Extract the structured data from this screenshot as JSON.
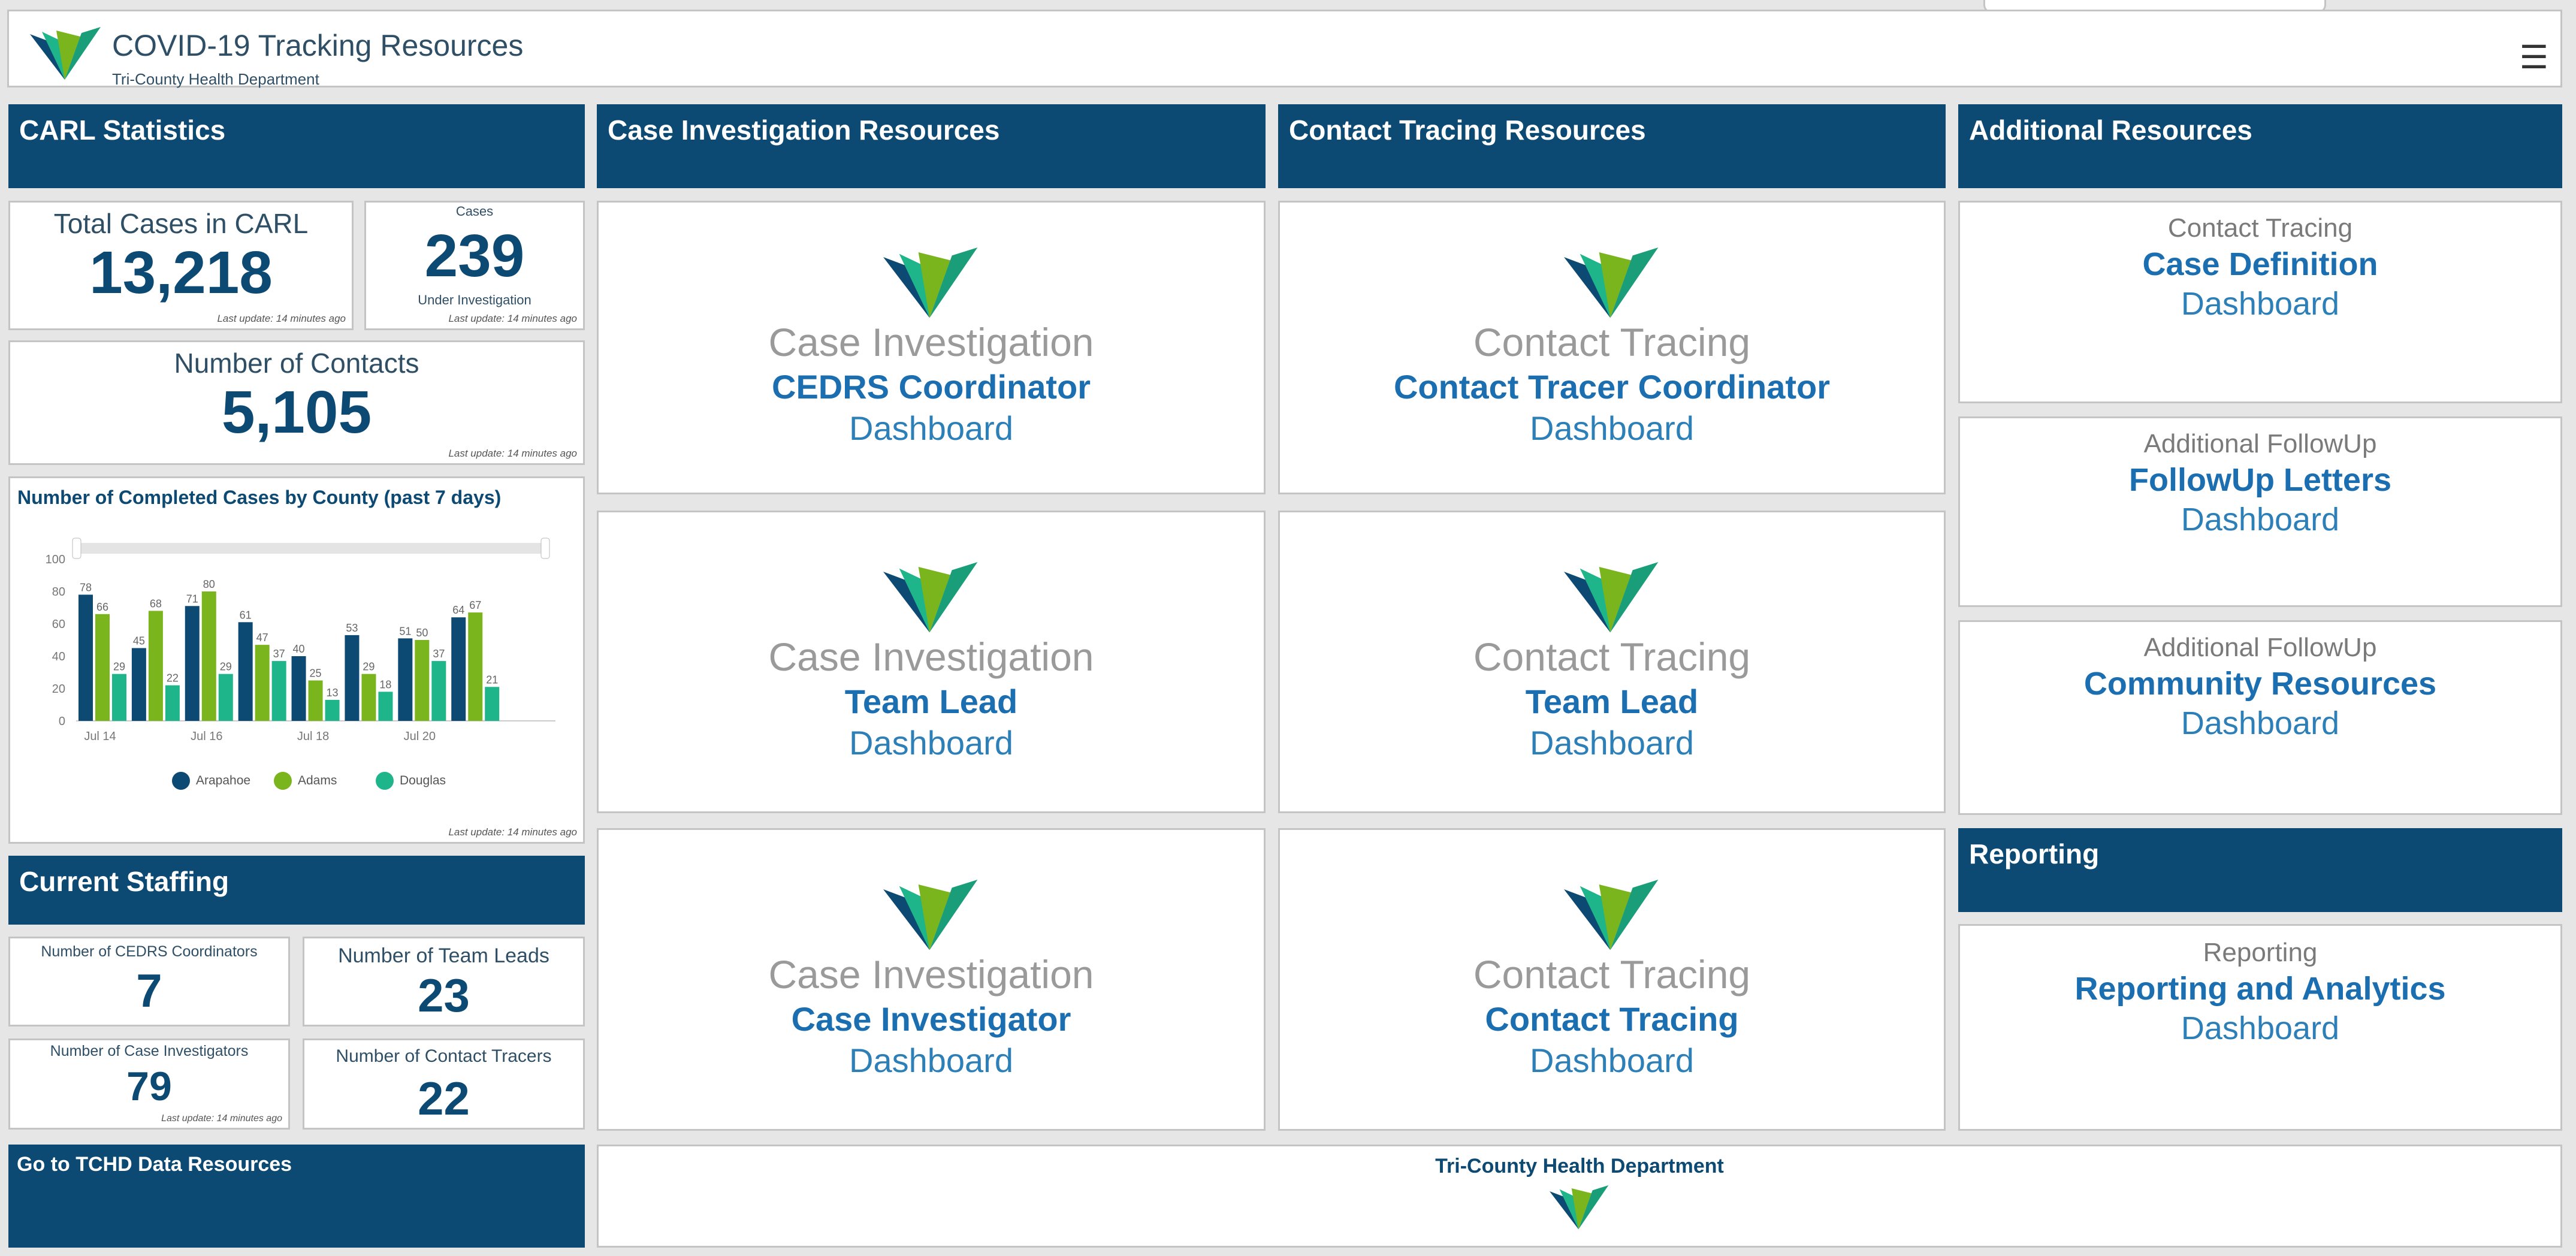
{
  "header": {
    "title": "COVID-19 Tracking Resources",
    "subtitle": "Tri-County Health Department",
    "menu_icon": "menu-icon"
  },
  "panels": {
    "carl": "CARL Statistics",
    "case_investigation": "Case Investigation Resources",
    "contact_tracing": "Contact Tracing Resources",
    "additional": "Additional Resources",
    "reporting": "Reporting",
    "staffing": "Current Staffing",
    "data_resources": "Go to TCHD Data Resources"
  },
  "stats": {
    "total_cases_label": "Total Cases in CARL",
    "total_cases": "13,218",
    "cases_label": "Cases",
    "cases_value": "239",
    "cases_sub": "Under Investigation",
    "contacts_label": "Number of Contacts",
    "contacts_value": "5,105",
    "last_update": "Last update: 14 minutes ago"
  },
  "staffing": {
    "cedrs_label": "Number of CEDRS Coordinators",
    "cedrs_value": "7",
    "team_leads_label": "Number of Team Leads",
    "team_leads_value": "23",
    "investigators_label": "Number of Case Investigators",
    "investigators_value": "79",
    "tracers_label": "Number of Contact Tracers",
    "tracers_value": "22",
    "last_update": "Last update: 14 minutes ago"
  },
  "case_cards": [
    {
      "category": "Case Investigation",
      "role": "CEDRS Coordinator",
      "dash": "Dashboard"
    },
    {
      "category": "Case Investigation",
      "role": "Team Lead",
      "dash": "Dashboard"
    },
    {
      "category": "Case Investigation",
      "role": "Case Investigator",
      "dash": "Dashboard"
    }
  ],
  "contact_cards": [
    {
      "category": "Contact Tracing",
      "role": "Contact Tracer Coordinator",
      "dash": "Dashboard"
    },
    {
      "category": "Contact Tracing",
      "role": "Team Lead",
      "dash": "Dashboard"
    },
    {
      "category": "Contact Tracing",
      "role": "Contact Tracing",
      "dash": "Dashboard"
    }
  ],
  "additional_cards": [
    {
      "category": "Contact Tracing",
      "role": "Case Definition",
      "dash": "Dashboard"
    },
    {
      "category": "Additional FollowUp",
      "role": "FollowUp Letters",
      "dash": "Dashboard"
    },
    {
      "category": "Additional FollowUp",
      "role": "Community Resources",
      "dash": "Dashboard"
    }
  ],
  "reporting_card": {
    "category": "Reporting",
    "role": "Reporting and Analytics",
    "dash": "Dashboard"
  },
  "footer": {
    "org": "Tri-County Health Department"
  },
  "colors": {
    "navy": "#0d4a73",
    "arapahoe": "#0d4a73",
    "adams": "#7ab51d",
    "douglas": "#1fb58a"
  },
  "chart_data": {
    "type": "bar",
    "title": "Number of Completed Cases by County (past 7 days)",
    "x_tick_labels": [
      "Jul 14",
      "Jul 16",
      "Jul 18",
      "Jul 20"
    ],
    "categories": [
      "1",
      "2",
      "3",
      "4",
      "5",
      "6",
      "7",
      "8",
      "9"
    ],
    "ylim": [
      0,
      100
    ],
    "y_ticks": [
      0,
      20,
      40,
      60,
      80,
      100
    ],
    "series": [
      {
        "name": "Arapahoe",
        "values": [
          78,
          45,
          71,
          61,
          40,
          53,
          51,
          64,
          null
        ]
      },
      {
        "name": "Adams",
        "values": [
          66,
          68,
          80,
          47,
          25,
          29,
          50,
          67,
          null
        ]
      },
      {
        "name": "Douglas",
        "values": [
          29,
          22,
          29,
          37,
          13,
          18,
          37,
          21,
          null
        ]
      }
    ],
    "grid": false,
    "legend": "bottom",
    "footer": "Last update: 14 minutes ago"
  }
}
